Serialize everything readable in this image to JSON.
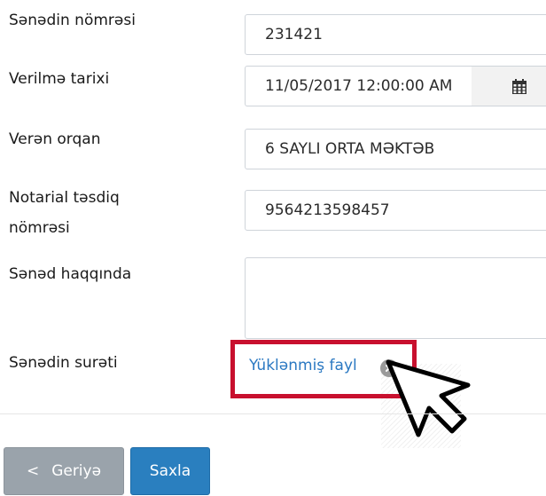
{
  "form": {
    "doc_number": {
      "label": "Sənədin nömrəsi",
      "value": "231421"
    },
    "issue_date": {
      "label": "Verilmə tarixi",
      "value": "11/05/2017 12:00:00 AM",
      "icon": "calendar-icon"
    },
    "issuer": {
      "label": "Verən orqan",
      "value": "6 SAYLI ORTA MƏKTƏB"
    },
    "notary": {
      "label_line1": "Notarial təsdiq",
      "label_line2": "nömrəsi",
      "value": "9564213598457"
    },
    "about": {
      "label": "Sənəd haqqında",
      "value": ""
    },
    "copy": {
      "label": "Sənədin surəti",
      "file_link": "Yüklənmiş fayl",
      "remove_icon": "close-circle-icon"
    }
  },
  "buttons": {
    "back_chevron": "<",
    "back_label": "Geriyə",
    "save_label": "Saxla"
  },
  "colors": {
    "highlight": "#c8102e",
    "link": "#2a78c2",
    "save_button": "#2a7fbf",
    "back_button": "#9aa3ab"
  }
}
